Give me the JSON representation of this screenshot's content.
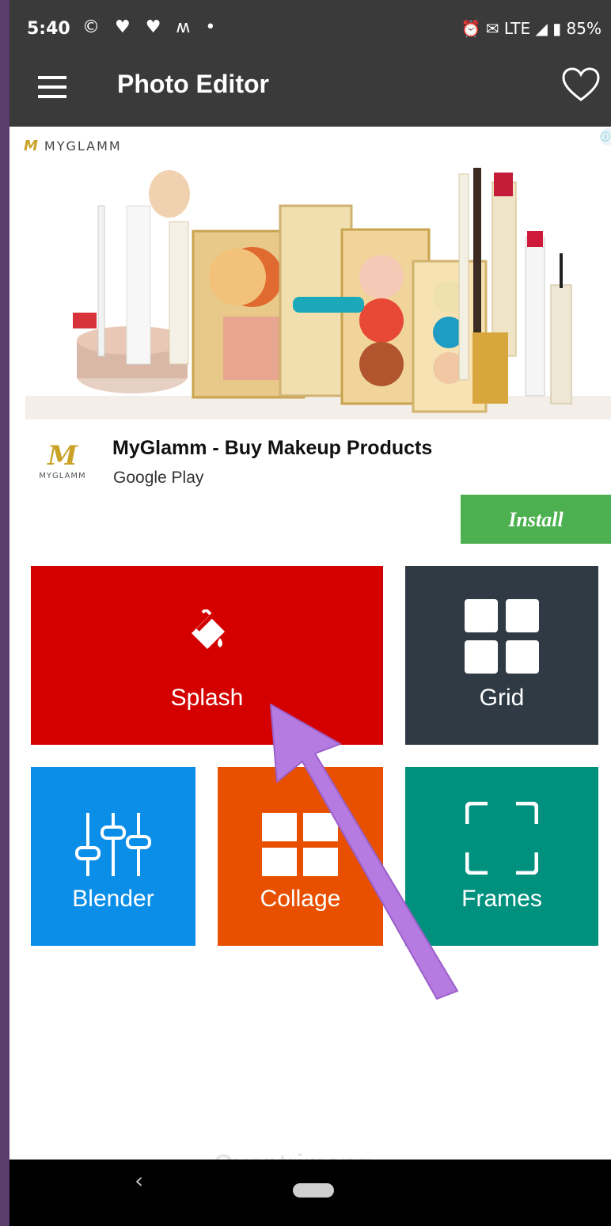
{
  "status_bar": {
    "time": "5:40",
    "left_icons": "© ♥ ♥ ʍ •",
    "right_text": "⏰ ✉ LTE ◢ ▮ 85%"
  },
  "toolbar": {
    "title": "Photo Editor",
    "menu_icon": "menu-icon",
    "favorite_icon": "heart-icon"
  },
  "ad": {
    "brand_logo": "M",
    "brand_name": "MYGLAMM",
    "corner_icon": "ⓘ",
    "app_logo_mark": "M",
    "app_logo_text": "MYGLAMM",
    "title": "MyGlamm - Buy Makeup Products",
    "subtitle": "Google Play",
    "install_label": "Install"
  },
  "tiles": {
    "splash": {
      "label": "Splash",
      "icon": "paint-bucket-icon",
      "color": "#d40000"
    },
    "grid": {
      "label": "Grid",
      "icon": "grid-icon",
      "color": "#2f3a45"
    },
    "blender": {
      "label": "Blender",
      "icon": "sliders-icon",
      "color": "#0b8ee8"
    },
    "collage": {
      "label": "Collage",
      "icon": "collage-icon",
      "color": "#e85000"
    },
    "frames": {
      "label": "Frames",
      "icon": "frame-corners-icon",
      "color": "#00917e"
    }
  },
  "overlay": {
    "annotation": "arrow-pointer",
    "color": "#b57be0"
  },
  "navbar": {
    "back_glyph": "‹"
  },
  "watermark": "Quantrimang"
}
